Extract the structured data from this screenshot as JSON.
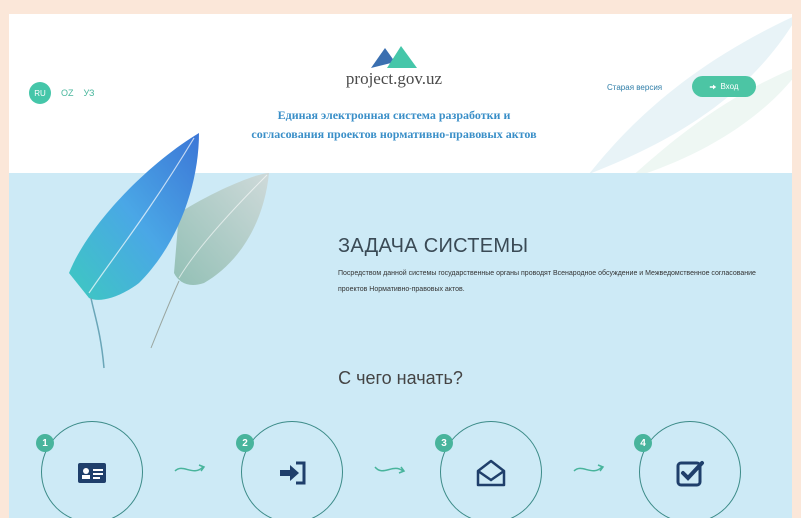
{
  "lang": [
    "RU",
    "OZ",
    "УЗ"
  ],
  "site": {
    "name": "project.gov.uz",
    "tagline": "Единая электронная система разработки и согласования проектов нормативно-правовых актов"
  },
  "header": {
    "old_version": "Старая версия",
    "login": "Вход"
  },
  "about": {
    "title": "ЗАДАЧА СИСТЕМЫ",
    "text": "Посредством данной системы государственные органы проводят Всенародное обсуждение и Межведомственное согласование проектов Нормативно-правовых актов."
  },
  "start": {
    "title": "С чего начать?",
    "steps": [
      {
        "num": "1",
        "icon": "id-card-icon"
      },
      {
        "num": "2",
        "icon": "sign-in-icon"
      },
      {
        "num": "3",
        "icon": "envelope-open-icon"
      },
      {
        "num": "4",
        "icon": "checkbox-icon"
      }
    ]
  },
  "colors": {
    "accent": "#45c6a9",
    "link": "#2f7ea8",
    "tagline": "#3a8fc8",
    "band": "#cdeaf6"
  }
}
